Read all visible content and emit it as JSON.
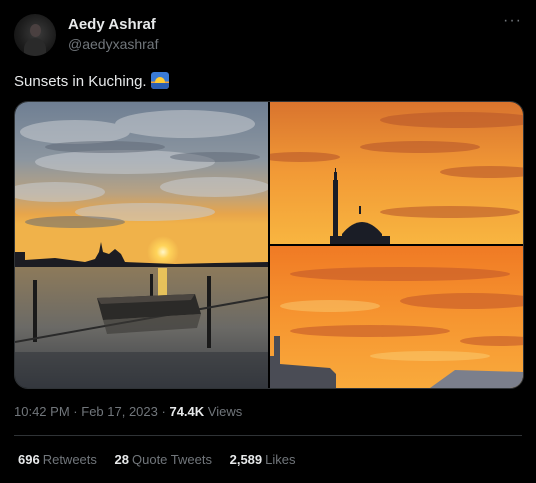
{
  "author": {
    "name": "Aedy Ashraf",
    "handle": "@aedyxashraf"
  },
  "tweet": {
    "text": "Sunsets in Kuching.",
    "emoji_icon": "sunrise-over-water-icon"
  },
  "menu_icon": "more-options-icon",
  "menu_glyph": "···",
  "meta": {
    "time": "10:42 PM",
    "separator": "·",
    "date": "Feb 17, 2023",
    "views_count": "74.4K",
    "views_label": "Views"
  },
  "stats": {
    "retweets_count": "696",
    "retweets_label": "Retweets",
    "quote_count": "28",
    "quote_label": "Quote Tweets",
    "likes_count": "2,589",
    "likes_label": "Likes"
  },
  "colors": {
    "background": "#000000",
    "text_primary": "#e7e9ea",
    "text_secondary": "#71767b",
    "border": "#2f3336"
  }
}
